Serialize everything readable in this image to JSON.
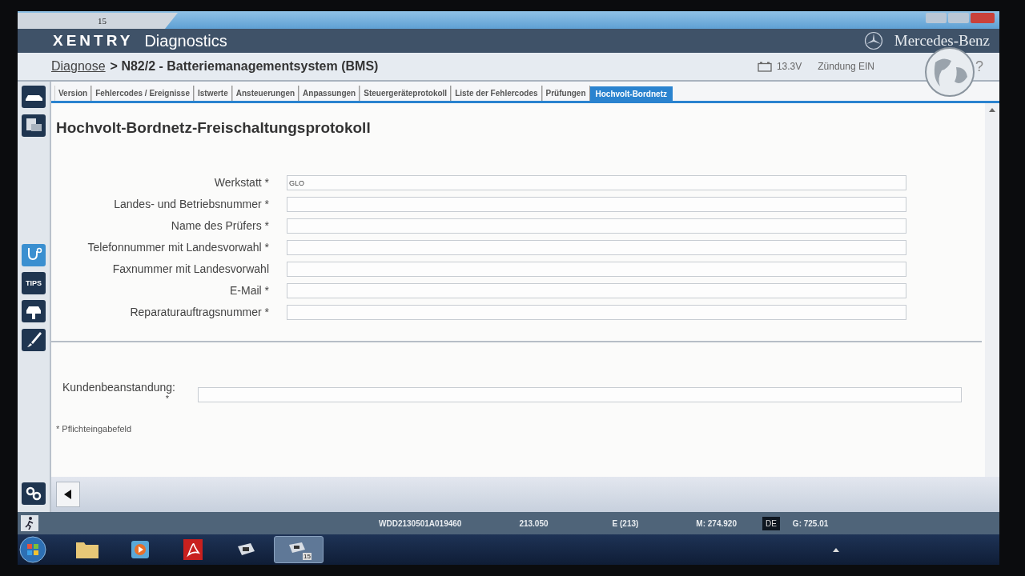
{
  "window": {
    "tab_label": "15"
  },
  "header": {
    "brand": "XENTRY",
    "product": "Diagnostics",
    "maker": "Mercedes-Benz"
  },
  "breadcrumb": {
    "link": "Diagnose",
    "current": "> N82/2 - Batteriemanagementsystem (BMS)"
  },
  "vehicle_info": {
    "voltage": "13.3V",
    "ignition": "Zündung EIN",
    "help": "?"
  },
  "sidebar": {
    "tips_label": "TIPS"
  },
  "tabs": [
    {
      "label": "Version",
      "selected": false
    },
    {
      "label": "Fehlercodes / Ereignisse",
      "selected": false
    },
    {
      "label": "Istwerte",
      "selected": false
    },
    {
      "label": "Ansteuerungen",
      "selected": false
    },
    {
      "label": "Anpassungen",
      "selected": false
    },
    {
      "label": "Steuergeräteprotokoll",
      "selected": false
    },
    {
      "label": "Liste der Fehlercodes",
      "selected": false
    },
    {
      "label": "Prüfungen",
      "selected": false
    },
    {
      "label": "Hochvolt-Bordnetz",
      "selected": true
    }
  ],
  "form": {
    "title": "Hochvolt-Bordnetz-Freischaltungsprotokoll",
    "fields": [
      {
        "label": "Werkstatt *",
        "value": "GLO"
      },
      {
        "label": "Landes- und Betriebsnummer *"
      },
      {
        "label": "Name des Prüfers *"
      },
      {
        "label": "Telefonnummer mit Landesvorwahl *"
      },
      {
        "label": "Faxnummer mit Landesvorwahl"
      },
      {
        "label": "E-Mail *"
      },
      {
        "label": "Reparaturauftragsnummer *"
      }
    ],
    "complaint": {
      "label": "Kundenbeanstandung:",
      "mark": "*"
    },
    "footnote": "* Pflichteingabefeld"
  },
  "status_bar": [
    {
      "kind": "text",
      "text": "WDD2130501A019460"
    },
    {
      "kind": "text",
      "text": "213.050"
    },
    {
      "kind": "text",
      "text": "E (213)"
    },
    {
      "kind": "text",
      "text": "M: 274.920"
    },
    {
      "kind": "badge",
      "text": "DE"
    },
    {
      "kind": "text",
      "text": "G: 725.01"
    }
  ],
  "taskbar": [
    {
      "kind": "folder",
      "selected": false
    },
    {
      "kind": "media",
      "selected": false
    },
    {
      "kind": "pdf",
      "selected": false
    },
    {
      "kind": "xentry",
      "selected": false
    },
    {
      "kind": "xentry15",
      "selected": true,
      "badge": "15"
    }
  ]
}
